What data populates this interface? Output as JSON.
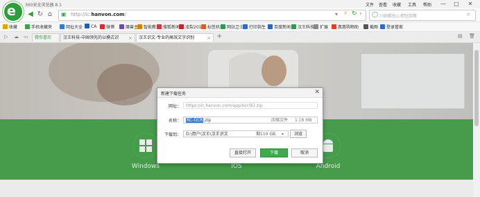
{
  "window": {
    "title": "360安全浏览器 8.1",
    "menu": [
      "文件",
      "查看",
      "收藏",
      "工具",
      "帮助"
    ],
    "controls": [
      "—",
      "□",
      "✕"
    ]
  },
  "nav": {
    "url_prefix": "http://",
    "url_host_start": "ic.",
    "url_host_bold": "hanvon.com",
    "url_host_end": "/",
    "search_placeholder": "川剧都化心挖吃炫敬"
  },
  "bookmarks": [
    {
      "label": "收藏",
      "color": "#e8a100"
    },
    {
      "label": "手机收藏夹",
      "color": "#3aa54a"
    },
    {
      "label": "网址大全",
      "color": "#2f7bd9"
    },
    {
      "label": "CA",
      "color": "#1f5fb8"
    },
    {
      "label": "微博",
      "color": "#d92b2b"
    },
    {
      "label": "魔兽主L",
      "color": "#6b4ab0"
    },
    {
      "label": "智能教育",
      "color": "#e07a00"
    },
    {
      "label": "搜狐新闻",
      "color": "#d33"
    },
    {
      "label": "凌梨201",
      "color": "#cc2222"
    },
    {
      "label": "标签机构",
      "color": "#e05a1a"
    },
    {
      "label": "网站卫士",
      "color": "#2a9d48"
    },
    {
      "label": "打印指生",
      "color": "#2a6ad1"
    },
    {
      "label": "百度新闻",
      "color": "#2b64c8"
    },
    {
      "label": "汉王科技",
      "color": "#2a9d48"
    },
    {
      "label": "扩展",
      "color": "#888888"
    },
    {
      "label": "惠惠购物助",
      "color": "#d42"
    },
    {
      "label": "截图",
      "color": "#555555"
    },
    {
      "label": "登录管家",
      "color": "#2a6ad1"
    }
  ],
  "tabs": [
    {
      "label": "猜你喜欢",
      "active": false
    },
    {
      "label": "汉王科技-中国领先的以模式识",
      "active": false
    },
    {
      "label": "汉王识文-专业的高效文字识别",
      "active": true
    }
  ],
  "page": {
    "platforms": [
      "Windows",
      "IOS",
      "Android"
    ]
  },
  "dialog": {
    "title": "新建下载任务",
    "url_label": "网址：",
    "url_value": "https://ic.hanvon.com/app/ocr/B1.zip",
    "name_label": "名称：",
    "name_selected": "RC-OCR",
    "name_ext": ".zip",
    "file_type": "压缩文件",
    "file_size": "1.18 MB",
    "saveto_label": "下载到：",
    "saveto_value": "D:\\用户\\汉王\\汉王识文",
    "free_space": "剩110 GB",
    "browse_button": "浏览",
    "open_button": "直接打开",
    "download_button": "下载",
    "cancel_button": "取消",
    "close": "✕"
  }
}
